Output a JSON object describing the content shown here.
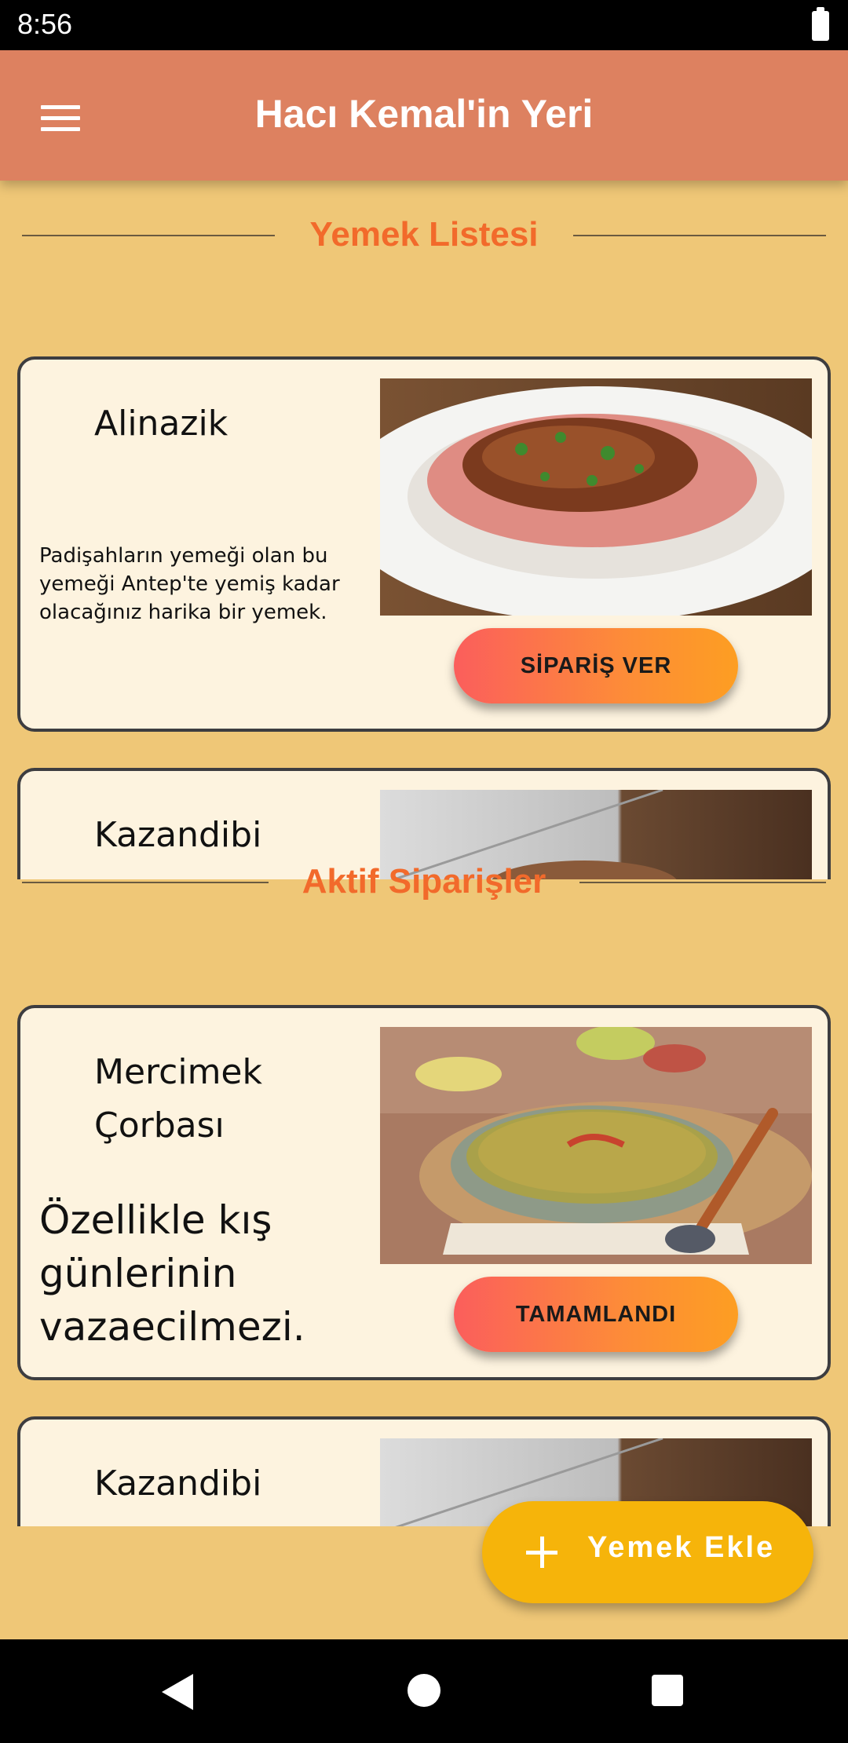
{
  "status_bar": {
    "time": "8:56",
    "battery_icon": "battery-full-icon"
  },
  "app_bar": {
    "title": "Hacı Kemal'in Yeri",
    "menu_icon": "hamburger-menu-icon"
  },
  "menu_section": {
    "title": "Yemek Listesi",
    "items": [
      {
        "name": "Alinazik",
        "description": "Padişahların yemeği olan bu yemeği Antep'te yemiş kadar olacağınız harika bir yemek.",
        "button": "SİPARİŞ VER",
        "image": "alinazik-photo"
      },
      {
        "name": "Kazandibi",
        "description": "",
        "button": "",
        "image": "kazandibi-photo"
      }
    ]
  },
  "orders_section": {
    "title": "Aktif Siparişler",
    "items": [
      {
        "name": "Mercimek Çorbası",
        "description": "Özellikle kış günlerinin vazaecilmezi.",
        "button": "TAMAMLANDI",
        "image": "lentil-soup-photo"
      },
      {
        "name": "Kazandibi",
        "description": "",
        "button": "",
        "image": "kazandibi-photo"
      }
    ]
  },
  "fab": {
    "label": "Yemek Ekle",
    "icon": "plus-icon"
  },
  "nav_bar": {
    "back": "back-icon",
    "home": "home-icon",
    "recents": "recents-icon"
  },
  "colors": {
    "background": "#efc777",
    "app_bar": "#dd8160",
    "section_title": "#f26a2b",
    "card": "#fdf3df",
    "fab": "#f6b40a"
  }
}
